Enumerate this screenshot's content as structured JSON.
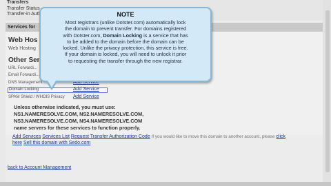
{
  "header": {
    "section_label": "Transfers",
    "status_label": "Transfer Status",
    "auth_label": "Transfer-in Auth..."
  },
  "services": {
    "section_title": "Services for",
    "web_hosting_heading": "Web Hos",
    "web_hosting_row": "Web Hosting",
    "other_heading": "Other Ser",
    "rows": [
      {
        "label": "URL Forwardi...",
        "add": ""
      },
      {
        "label": "Email Forwardi...",
        "add": ""
      },
      {
        "label": "DNS Management",
        "add": "Add Service"
      },
      {
        "label": "Domain Locking",
        "add": "Add Service"
      },
      {
        "label": "SPAM Shield / WHOIS Privacy",
        "add": "Add Service"
      }
    ]
  },
  "nameservers": {
    "intro": "Unless otherwise indicated, you must use:",
    "ns1_2": "NS1.NAMERESOLVE.COM, NS2.NAMERESOLVE.COM,",
    "ns3_4": "NS3.NAMERESOLVE.COM, NS4.NAMERESOLVE.COM",
    "outro": "name servers for these services to function properly."
  },
  "links": {
    "add_services": "Add Services",
    "services_list": "Services List",
    "request_auth": "Request Transfer Authorization Code",
    "move_note": "If you would like to move this domain to another account, please",
    "click": "click",
    "here": "here",
    "sell": "Sell this domain with Sedo.com",
    "back": "back to Account Management"
  },
  "note": {
    "title": "NOTE",
    "line1": "Most registrars (unlike Dotster.com) automatically lock",
    "line2": "the domain to prevent transfer.  For domains registered",
    "line3_pre": "with Dotster.com, ",
    "line3_bold": "Domain Locking",
    "line3_post": " is a service that has",
    "line4": "to be added to the domain before the domain can be",
    "line5": "locked.  Unlike the privacy protection, this service is free.",
    "line6": "If your domain is locked, you will need to unlock it prior",
    "line7": "to requesting the transfer through the new registrar."
  },
  "colors": {
    "link": "#1a3a9a",
    "note_bg": "#d3e9f7",
    "note_border": "#8ab7d6"
  }
}
